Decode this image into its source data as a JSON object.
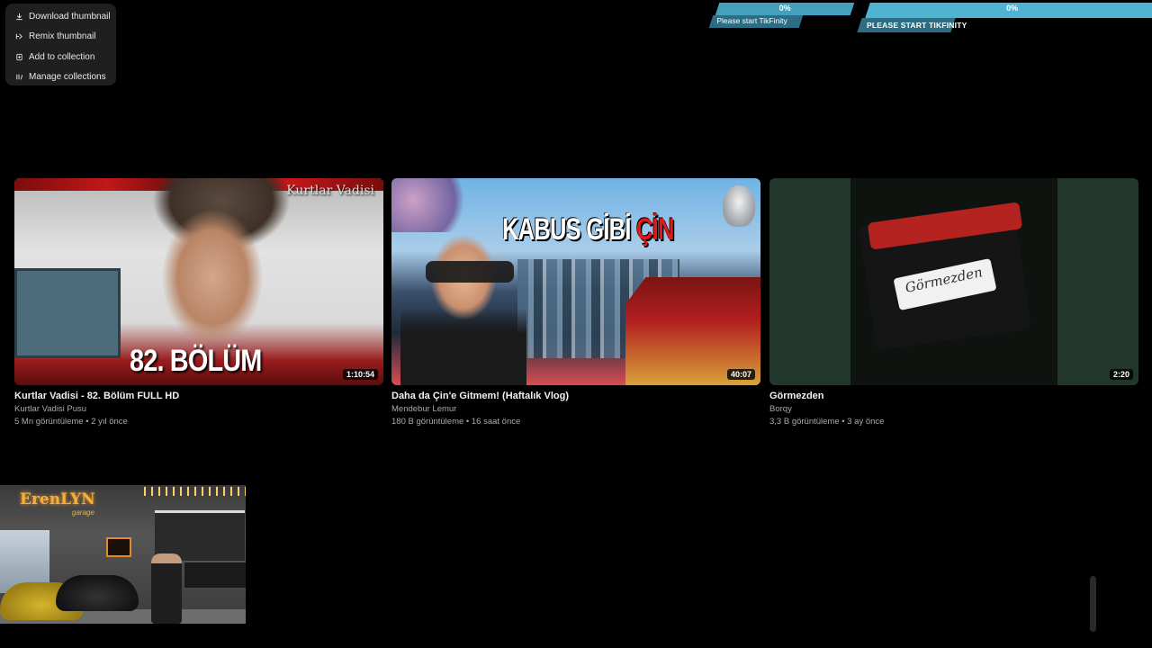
{
  "context_menu": {
    "items": [
      {
        "label": "Download thumbnail",
        "icon": "download-icon"
      },
      {
        "label": "Remix thumbnail",
        "icon": "remix-icon"
      },
      {
        "label": "Add to collection",
        "icon": "collection-add-icon"
      },
      {
        "label": "Manage collections",
        "icon": "collections-icon"
      }
    ]
  },
  "tikfinity": {
    "small": {
      "percent": "0%",
      "label": "Please start TikFinity",
      "progress": 0
    },
    "large": {
      "percent": "0%",
      "label": "PLEASE START TIKFINITY",
      "progress": 0
    }
  },
  "videos": [
    {
      "title": "Kurtlar Vadisi - 82. Bölüm FULL HD",
      "channel": "Kurtlar Vadisi Pusu",
      "meta": "5 Mn görüntüleme • 2 yıl önce",
      "duration": "1:10:54",
      "thumb_text": "82. BÖLÜM",
      "thumb_brand": "Kurtlar Vadisi"
    },
    {
      "title": "Daha da Çin'e Gitmem! (Haftalık Vlog)",
      "channel": "Mendebur Lemur",
      "meta": "180 B görüntüleme • 16 saat önce",
      "duration": "40:07",
      "thumb_text_main": "KABUS GİBİ ",
      "thumb_text_accent": "ÇİN"
    },
    {
      "title": "Görmezden",
      "channel": "Borqy",
      "meta": "3,3 B görüntüleme • 3 ay önce",
      "duration": "2:20",
      "thumb_text": "Görmezden"
    }
  ],
  "bottom_thumb": {
    "sign": "ErenLYN",
    "sign_sub": "garage"
  },
  "colors": {
    "background": "#000000",
    "tikfinity_bar": "#4fb3d2",
    "tikfinity_label": "#2d6d84",
    "menu_bg": "#1f1f1f",
    "accent_red": "#e2181d"
  }
}
